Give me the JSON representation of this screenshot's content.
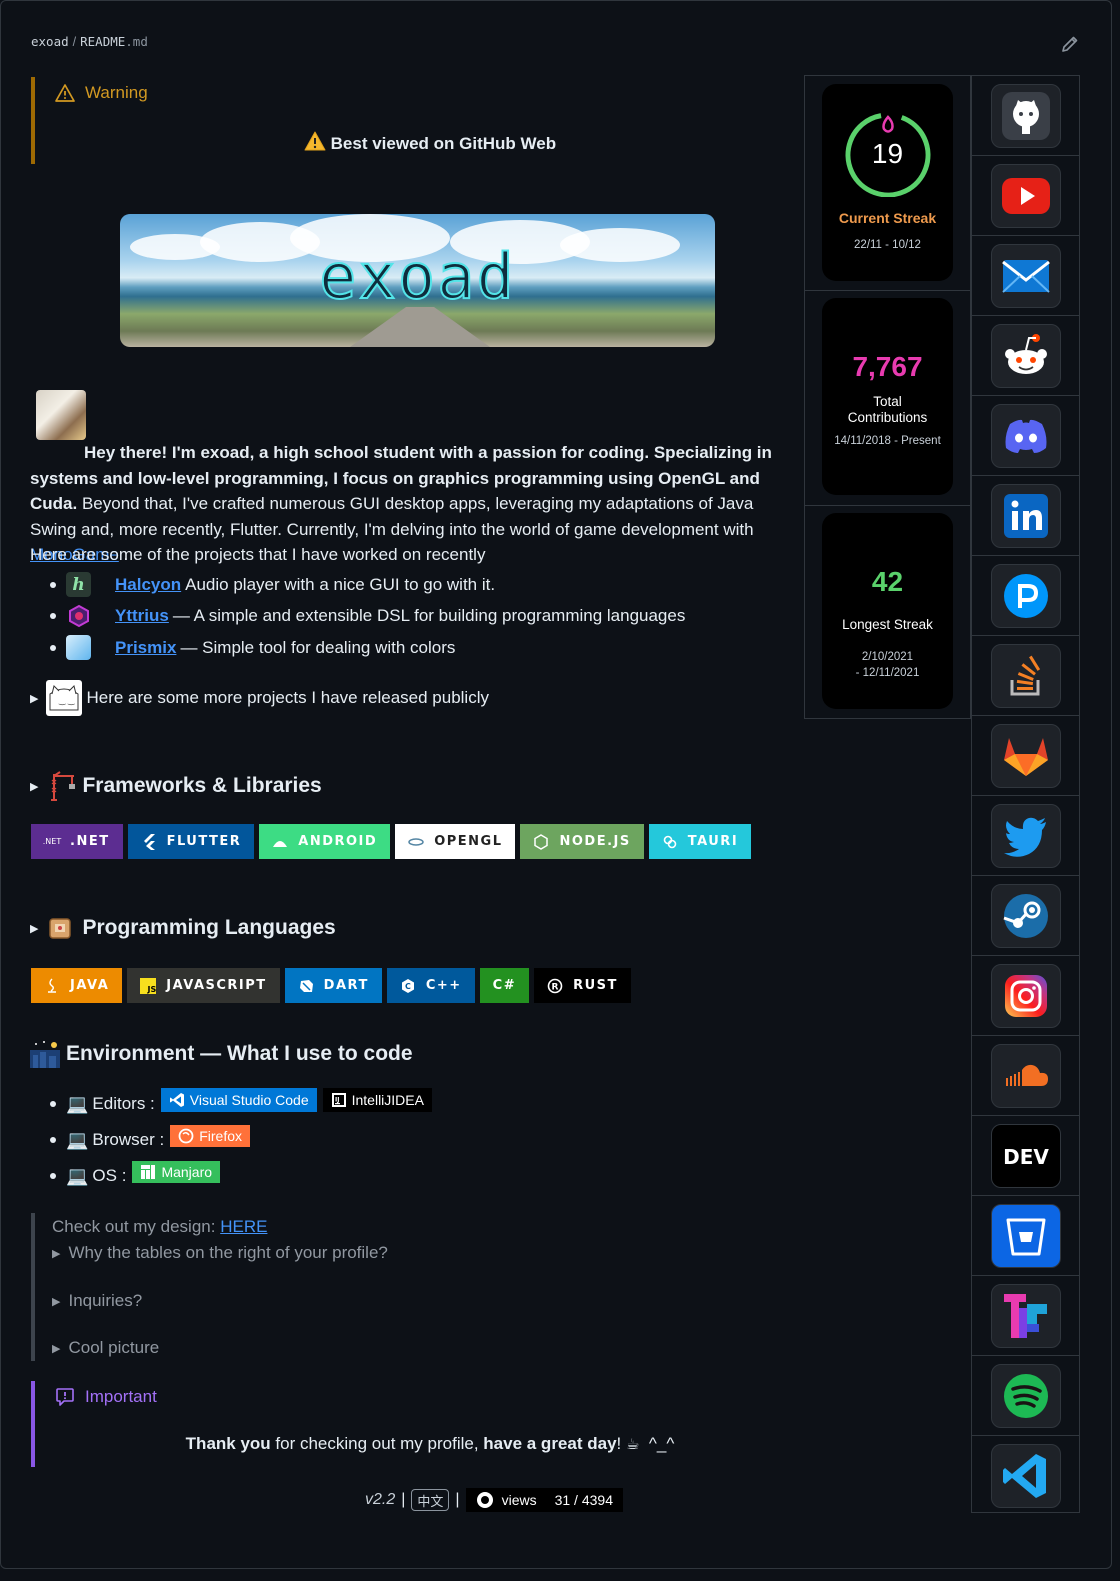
{
  "breadcrumb": {
    "owner": "exoad",
    "separator": "/",
    "file_name": "README",
    "file_ext": ".md"
  },
  "warning": {
    "title": "Warning",
    "message": "Best viewed on GitHub Web"
  },
  "banner": {
    "title": "exoad"
  },
  "intro": {
    "bold_text": "Hey there! I'm exoad, a high school student with a passion for coding. Specializing in systems and low-level programming, I focus on graphics programming using OpenGL and Cuda.",
    "text": " Beyond that, I've crafted numerous GUI desktop apps, leveraging my adaptations of Java Swing and, more recently, Flutter. Currently, I'm delving into the world of game development with ",
    "link": "MonoGame",
    "end": " ."
  },
  "projects": {
    "intro": "Here are some of the projects that I have worked on recently",
    "items": [
      {
        "name": "Halcyon",
        "desc": "Audio player with a nice GUI to go with it."
      },
      {
        "name": "Yttrius",
        "desc": "— A simple and extensible DSL for building programming languages"
      },
      {
        "name": "Prismix",
        "desc": "— Simple tool for dealing with colors"
      }
    ],
    "more_label": "Here are some more projects I have released publicly"
  },
  "frameworks": {
    "title": "Frameworks & Libraries",
    "badges": [
      {
        "label": ".NET",
        "icon": ".NET",
        "color": "#5c2d91"
      },
      {
        "label": "FLUTTER",
        "icon": "flutter-icon",
        "color": "#02569b"
      },
      {
        "label": "ANDROID",
        "icon": "android-icon",
        "color": "#3ddc84"
      },
      {
        "label": "OPENGL",
        "icon": "opengl-icon",
        "color": "#ffffff"
      },
      {
        "label": "NODE.JS",
        "icon": "nodejs-icon",
        "color": "#6da55f"
      },
      {
        "label": "TAURI",
        "icon": "tauri-icon",
        "color": "#24c8db"
      }
    ]
  },
  "languages": {
    "title": "Programming Languages",
    "badges": [
      {
        "label": "JAVA",
        "icon": "java-icon",
        "color": "#ed8b00"
      },
      {
        "label": "JAVASCRIPT",
        "icon": "JS",
        "color": "#323330"
      },
      {
        "label": "DART",
        "icon": "dart-icon",
        "color": "#0175c2"
      },
      {
        "label": "C++",
        "icon": "cpp-icon",
        "color": "#00599c"
      },
      {
        "label": "C#",
        "icon": "",
        "color": "#239120"
      },
      {
        "label": "RUST",
        "icon": "rust-icon",
        "color": "#000000"
      }
    ]
  },
  "environment": {
    "title": "Environment — What I use to code",
    "editors_label": "Editors :",
    "editor_1": "Visual Studio Code",
    "editor_2": "IntelliJIDEA",
    "browser_label": "Browser :",
    "browser": "Firefox",
    "os_label": "OS :",
    "os": "Manjaro"
  },
  "quote": {
    "design_text": "Check out my design: ",
    "design_link": "HERE",
    "summaries": [
      "Why the tables on the right of your profile?",
      "Inquiries?",
      "Cool picture"
    ]
  },
  "important": {
    "title": "Important",
    "thanks_bold": "Thank you",
    "thanks_mid": " for checking out my profile, ",
    "thanks_bold2": "have a great day",
    "thanks_end": "! ",
    "smile": "^_^"
  },
  "footer": {
    "version": "v2.2",
    "sep": "|",
    "lang": "中文",
    "views_label": "views",
    "views_value": "31 / 4394"
  },
  "stats": {
    "current_streak": {
      "value": "19",
      "label": "Current Streak",
      "range": "22/11 - 10/12"
    },
    "total": {
      "value": "7,767",
      "label_line1": "Total",
      "label_line2": "Contributions",
      "range": "14/11/2018 - Present"
    },
    "longest": {
      "value": "42",
      "label": "Longest Streak",
      "range_line1": "2/10/2021",
      "range_line2": "- 12/11/2021"
    }
  },
  "social": {
    "items": [
      "github-icon",
      "youtube-icon",
      "mail-icon",
      "reddit-icon",
      "discord-icon",
      "linkedin-icon",
      "pixiv-icon",
      "stackoverflow-icon",
      "gitlab-icon",
      "twitter-icon",
      "steam-icon",
      "instagram-icon",
      "soundcloud-icon",
      "dev-icon",
      "bitbucket-icon",
      "toptal-icon",
      "spotify-icon",
      "vscode-icon"
    ],
    "dev_text": "DEV"
  },
  "colors": {
    "warning": "#d29922",
    "important": "#a371f7",
    "link": "#4493f8",
    "streak_ring": "#5ad16b",
    "streak_flame": "#e83bb0",
    "total": "#e83bb0"
  }
}
